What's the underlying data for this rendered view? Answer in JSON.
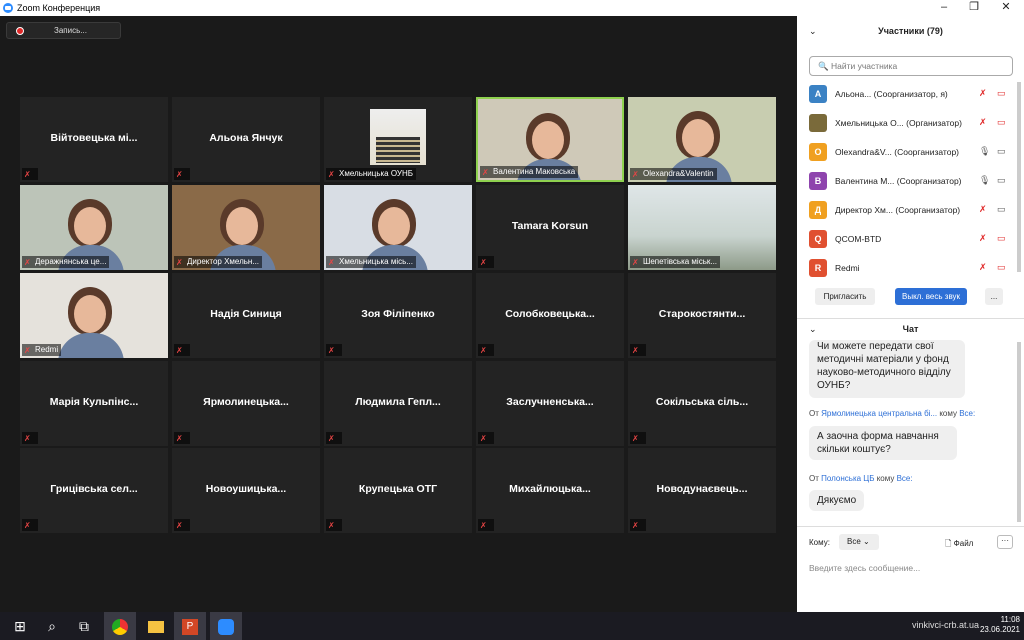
{
  "window": {
    "title": "Zoom Конференция"
  },
  "recording": {
    "label": "Запись..."
  },
  "tiles": [
    {
      "name": "Війтовецька мі...",
      "caption": ""
    },
    {
      "name": "Альона Янчук",
      "caption": ""
    },
    {
      "name": "",
      "caption": "Хмельницька ОУНБ"
    },
    {
      "name": "",
      "caption": "Валентина Маковська"
    },
    {
      "name": "",
      "caption": "Olexandra&Valentin"
    },
    {
      "name": "",
      "caption": "Деражнянська це..."
    },
    {
      "name": "",
      "caption": "Директор Хмельн..."
    },
    {
      "name": "",
      "caption": "Хмельницька місь..."
    },
    {
      "name": "Tamara Korsun",
      "caption": ""
    },
    {
      "name": "",
      "caption": "Шепетівська міськ..."
    },
    {
      "name": "",
      "caption": "Redmi"
    },
    {
      "name": "Надія Синиця",
      "caption": ""
    },
    {
      "name": "Зоя Філіпенко",
      "caption": ""
    },
    {
      "name": "Солобковецька...",
      "caption": ""
    },
    {
      "name": "Старокостянти...",
      "caption": ""
    },
    {
      "name": "Марія Кульпінс...",
      "caption": ""
    },
    {
      "name": "Ярмолинецька...",
      "caption": ""
    },
    {
      "name": "Людмила Гепл...",
      "caption": ""
    },
    {
      "name": "Заслучненська...",
      "caption": ""
    },
    {
      "name": "Сокільська сіль...",
      "caption": ""
    },
    {
      "name": "Грицівська сел...",
      "caption": ""
    },
    {
      "name": "Новоушицька...",
      "caption": ""
    },
    {
      "name": "Крупецька ОТГ",
      "caption": ""
    },
    {
      "name": "Михайлюцька...",
      "caption": ""
    },
    {
      "name": "Новодунаєвець...",
      "caption": ""
    }
  ],
  "participants": {
    "header": "Участники (79)",
    "search_placeholder": "Найти участника",
    "list": [
      {
        "initial": "А",
        "color": "#3b82c4",
        "name": "Альона...",
        "role": "(Соорганизатор, я)"
      },
      {
        "initial": "",
        "color": "#7a6a3a",
        "name": "Хмельницька О...",
        "role": "(Организатор)"
      },
      {
        "initial": "O",
        "color": "#f0a020",
        "name": "Olexandra&V...",
        "role": "(Соорганизатор)"
      },
      {
        "initial": "В",
        "color": "#8e44ad",
        "name": "Валентина М...",
        "role": "(Соорганизатор)"
      },
      {
        "initial": "Д",
        "color": "#f0a020",
        "name": "Директор Хм...",
        "role": "(Соорганизатор)"
      },
      {
        "initial": "Q",
        "color": "#e05030",
        "name": "QCOM-BTD",
        "role": ""
      },
      {
        "initial": "R",
        "color": "#e05030",
        "name": "Redmi",
        "role": ""
      }
    ],
    "invite_label": "Пригласить",
    "mute_all_label": "Выкл. весь звук",
    "more_label": "..."
  },
  "chat": {
    "header": "Чат",
    "messages": [
      {
        "from": "",
        "to": "",
        "text": "Чи можете передати свої методичні матеріали у фонд науково-методичного відділу ОУНБ?"
      },
      {
        "from": "Ярмолинецька центральна бі...",
        "to": "Все:",
        "text": "А заочна форма навчання скільки коштує?"
      },
      {
        "from": "Полонська ЦБ",
        "to": "Все:",
        "text": "Дякуємо"
      }
    ],
    "from_word": "От",
    "to_word": "кому",
    "to_label": "Кому:",
    "to_value": "Все",
    "file_label": "Файл",
    "input_placeholder": "Введите здесь сообщение..."
  },
  "taskbar": {
    "time": "11:08",
    "date": "23.06.2021",
    "watermark": "vinkivci-crb.at.ua"
  }
}
